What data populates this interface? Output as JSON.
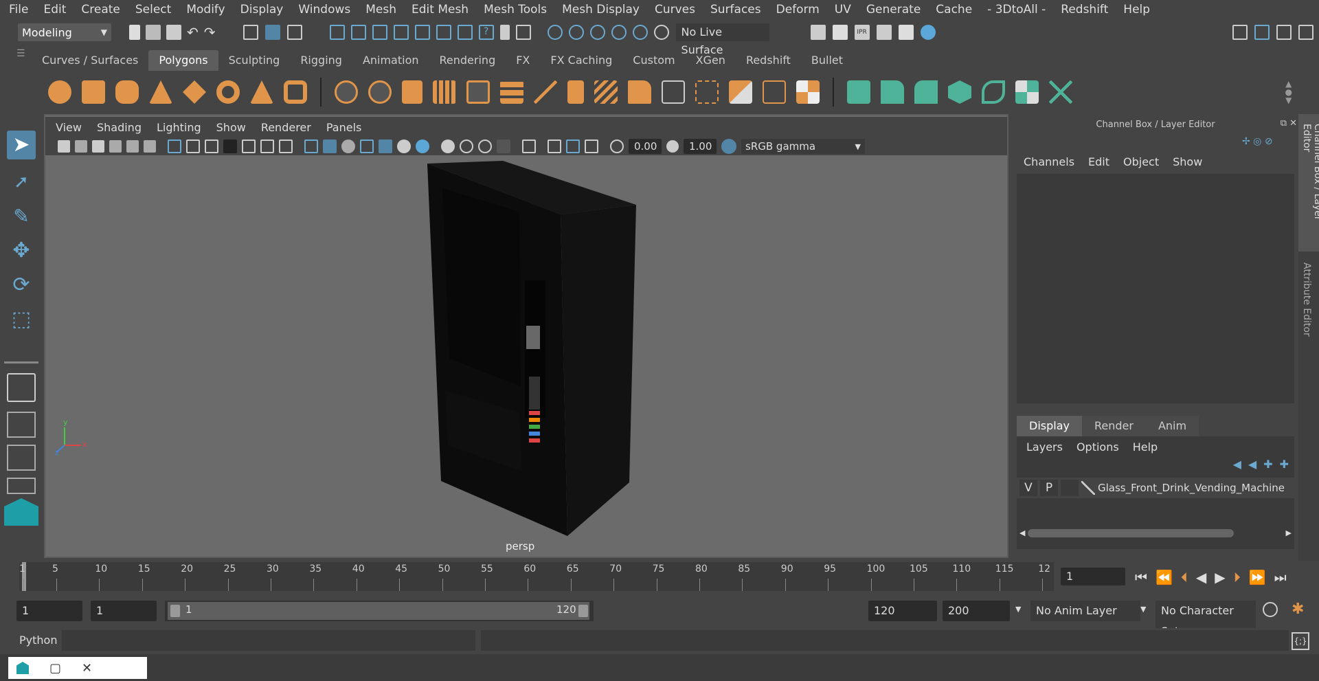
{
  "menubar": {
    "items": [
      "File",
      "Edit",
      "Create",
      "Select",
      "Modify",
      "Display",
      "Windows",
      "Mesh",
      "Edit Mesh",
      "Mesh Tools",
      "Mesh Display",
      "Curves",
      "Surfaces",
      "Deform",
      "UV",
      "Generate",
      "Cache",
      "- 3DtoAll -",
      "Redshift",
      "Help"
    ]
  },
  "toolbar": {
    "mode": "Modeling",
    "live_surface": "No Live Surface"
  },
  "shelf": {
    "tabs": [
      "Curves / Surfaces",
      "Polygons",
      "Sculpting",
      "Rigging",
      "Animation",
      "Rendering",
      "FX",
      "FX Caching",
      "Custom",
      "XGen",
      "Redshift",
      "Bullet"
    ],
    "active_tab": "Polygons"
  },
  "viewport": {
    "menu": [
      "View",
      "Shading",
      "Lighting",
      "Show",
      "Renderer",
      "Panels"
    ],
    "exposure": "0.00",
    "gamma": "1.00",
    "color_space": "sRGB gamma",
    "camera_label": "persp",
    "axis_x": "x",
    "axis_y": "y",
    "axis_z": "z"
  },
  "channel_box": {
    "title": "Channel Box / Layer Editor",
    "menu": [
      "Channels",
      "Edit",
      "Object",
      "Show"
    ]
  },
  "layer_editor": {
    "tabs": [
      "Display",
      "Render",
      "Anim"
    ],
    "active_tab": "Display",
    "menu": [
      "Layers",
      "Options",
      "Help"
    ],
    "layer": {
      "v": "V",
      "p": "P",
      "name": "Glass_Front_Drink_Vending_Machine"
    }
  },
  "side_tabs": {
    "channel_box": "Channel Box / Layer Editor",
    "attribute_editor": "Attribute Editor"
  },
  "timeline": {
    "ticks": [
      "1",
      "5",
      "10",
      "15",
      "20",
      "25",
      "30",
      "35",
      "40",
      "45",
      "50",
      "55",
      "60",
      "65",
      "70",
      "75",
      "80",
      "85",
      "90",
      "95",
      "100",
      "105",
      "110",
      "115",
      "12"
    ],
    "current_frame": "1"
  },
  "range": {
    "start": "1",
    "playback_start": "1",
    "slider_start": "1",
    "slider_end": "120",
    "playback_end": "120",
    "end": "200",
    "anim_layer": "No Anim Layer",
    "character_set": "No Character Set"
  },
  "command_line": {
    "language": "Python"
  },
  "colors": {
    "accent": "#5285a6",
    "poly_icon": "#e0954a",
    "green_icon": "#4fb39a"
  }
}
